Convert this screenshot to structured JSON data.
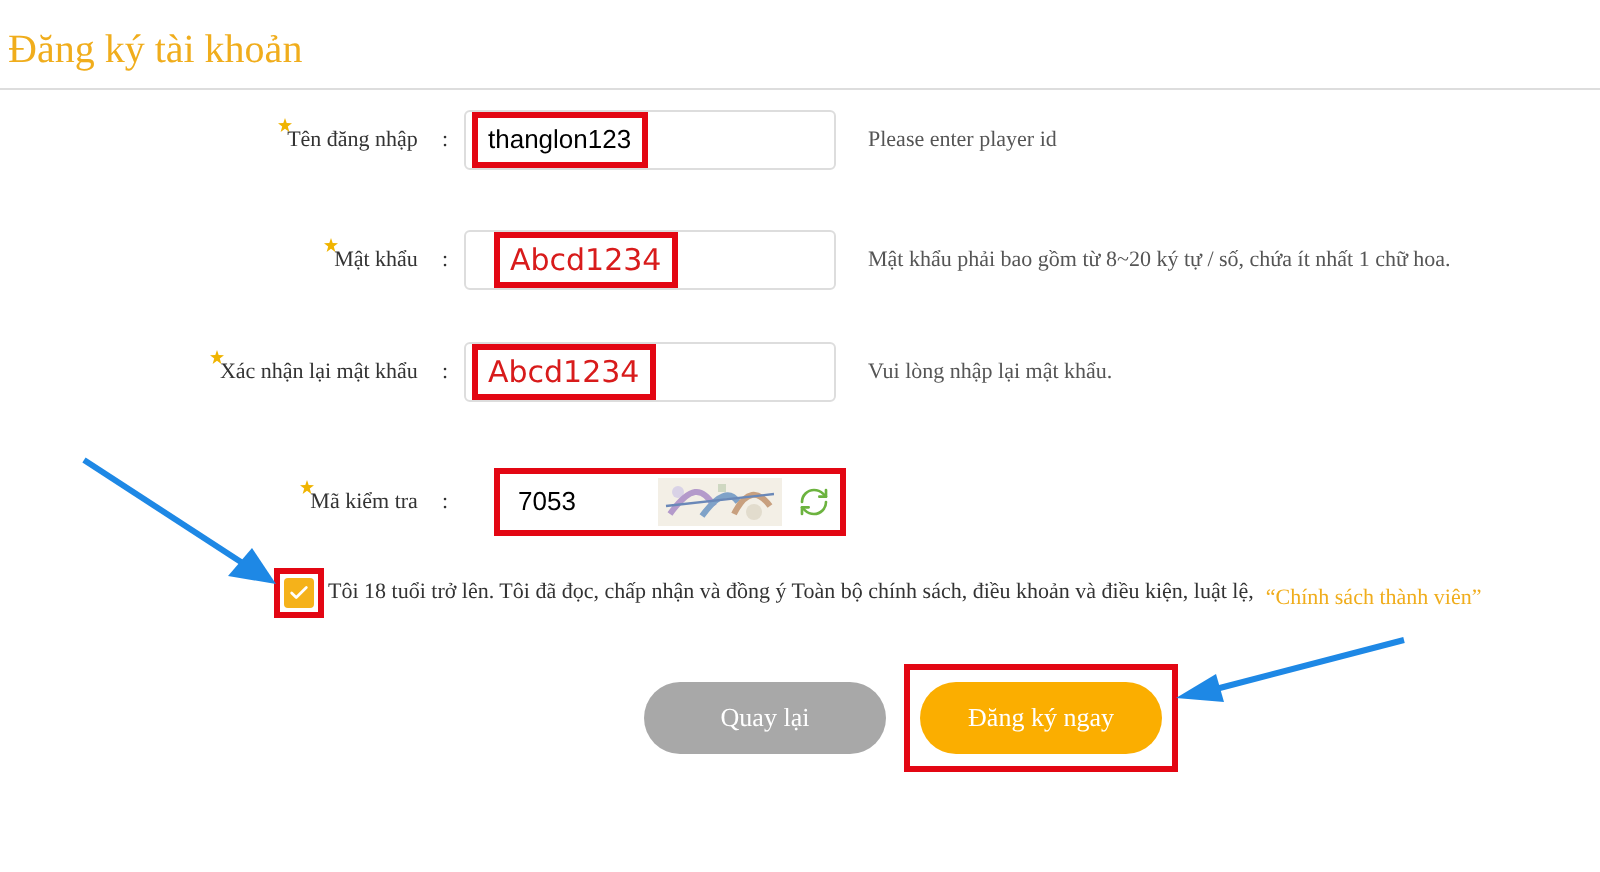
{
  "title": "Đăng ký tài khoản",
  "fields": [
    {
      "label": "Tên đăng nhập",
      "colon": ":",
      "value": "thanglon123",
      "kind": "plain",
      "hint": "Please enter player id"
    },
    {
      "label": "Mật khẩu",
      "colon": ":",
      "value": "Abcd1234",
      "kind": "marked",
      "hint": "Mật khẩu phải bao gồm từ 8~20 ký tự / số, chứa ít nhất 1 chữ hoa."
    },
    {
      "label": "Xác nhận lại mật khẩu",
      "colon": ":",
      "value": "Abcd1234",
      "kind": "marked",
      "hint": "Vui lòng nhập lại mật khẩu."
    },
    {
      "label": "Mã kiểm tra",
      "colon": ":",
      "value": "7053",
      "kind": "captcha"
    }
  ],
  "agreement": {
    "checked": true,
    "text": "Tôi 18 tuổi trở lên. Tôi đã đọc, chấp nhận và đồng ý Toàn bộ chính sách, điều khoản và điều kiện, luật lệ,",
    "link": "“Chính sách thành viên”"
  },
  "buttons": [
    {
      "label": "Quay lại",
      "kind": "secondary"
    },
    {
      "label": "Đăng ký ngay",
      "kind": "primary"
    }
  ]
}
